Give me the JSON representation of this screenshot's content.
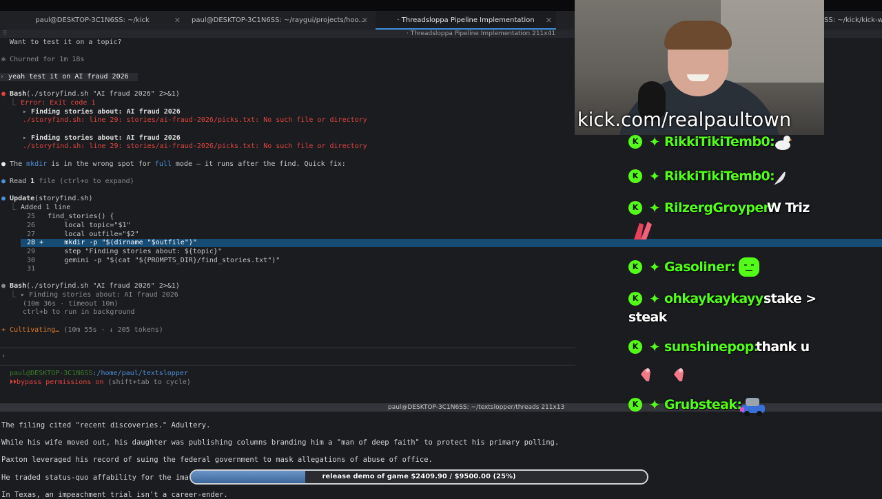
{
  "tabs": [
    {
      "label": "paul@DESKTOP-3C1N6SS: ~/kick"
    },
    {
      "label": "paul@DESKTOP-3C1N6SS: ~/raygui/projects/hoo..."
    },
    {
      "label": "· Threadsloppa Pipeline Implementation"
    },
    {
      "label": "SS: ~/kick/kick-w"
    }
  ],
  "pane1_title": "· Threadsloppa Pipeline Implementation 211x41",
  "terminal": {
    "line_question": "Want to test it on a topic?",
    "line_churned": "Churned for 1m 18s",
    "line_prompt": "yeah test it on AI fraud 2026",
    "bash1_name": "Bash",
    "bash1_args": "(./storyfind.sh \"AI fraud 2026\" 2>&1)",
    "bash1_error": "Error: Exit code 1",
    "find1": "Finding stories about: AI fraud 2026",
    "err1": "./storyfind.sh: line 29: stories/ai-fraud-2026/picks.txt: No such file or directory",
    "find2": "Finding stories about: AI fraud 2026",
    "err2": "./storyfind.sh: line 29: stories/ai-fraud-2026/picks.txt: No such file or directory",
    "explain_pre": "The ",
    "explain_mkdir": "mkdir",
    "explain_mid": " is in the wrong spot for ",
    "explain_full": "full",
    "explain_post": " mode — it runs after the find. Quick fix:",
    "read_label": "Read ",
    "read_bold": "1",
    "read_rest": " file (ctrl+o to expand)",
    "update_name": "Update",
    "update_args": "(storyfind.sh)",
    "update_added": "Added 1 line",
    "code": [
      {
        "num": "25",
        "mark": " ",
        "text": "find_stories() {"
      },
      {
        "num": "26",
        "mark": " ",
        "text": "    local topic=\"$1\""
      },
      {
        "num": "27",
        "mark": " ",
        "text": "    local outfile=\"$2\""
      },
      {
        "num": "28",
        "mark": "+",
        "text": "    mkdir -p \"$(dirname \"$outfile\")\""
      },
      {
        "num": "29",
        "mark": " ",
        "text": "    step \"Finding stories about: ${topic}\""
      },
      {
        "num": "30",
        "mark": " ",
        "text": "    gemini -p \"$(cat \"${PROMPTS_DIR}/find_stories.txt\")\""
      },
      {
        "num": "31",
        "mark": " ",
        "text": ""
      }
    ],
    "bash2_name": "Bash",
    "bash2_args": "(./storyfind.sh \"AI fraud 2026\" 2>&1)",
    "bash2_find": "Finding stories about: AI fraud 2026",
    "bash2_time": "(10m 36s · timeout 10m)",
    "bash2_bg": "ctrl+b to run in background",
    "cultivating": "Cultivating…",
    "cultivating_meta": "(10m 55s · ↓ 205 tokens)",
    "cursor": "›",
    "shell_user": "paul@DESKTOP-3C1N6SS",
    "shell_path": ":/home/paul/textslopper",
    "bypass_bold": "bypass permissions on",
    "bypass_rest": " (shift+tab to cycle)"
  },
  "pane2_title": "paul@DESKTOP-3C1N6SS: ~/textslopper/threads 211x13",
  "pane2_lines": [
    "The filing cited \"recent discoveries.\" Adultery.",
    "While his wife moved out, his daughter was publishing columns branding him a \"man of deep faith\" to protect his primary polling.",
    "Paxton leveraged his record of suing the federal government to mask allegations of abuse of office.",
    "He traded status-quo affability for the ima",
    "In Texas, an impeachment trial isn't a career-ender."
  ],
  "stream_url": "kick.com/realpaultown",
  "chat": [
    {
      "user": "RikkiTikiTemb0:",
      "text": "",
      "emote": "duck"
    },
    {
      "user": "RikkiTikiTemb0:",
      "text": "",
      "emote": "feather"
    },
    {
      "user": "RilzergGroyper:",
      "text": "W Triz",
      "emote": "hands"
    },
    {
      "user": "Gasoliner:",
      "text": "",
      "emote": "blob"
    },
    {
      "user": "ohkaykaykayy:",
      "text": "stake >",
      "cont": "steak"
    },
    {
      "user": "sunshinepop:",
      "text": "thank u",
      "emote": "birds"
    },
    {
      "user": "Grubsteak:",
      "text": "",
      "emote": "car"
    }
  ],
  "progress": {
    "label": "release demo of game $2409.90 / $9500.00 (25%)",
    "fraction": 0.25
  },
  "colors": {
    "kick_green": "#53fc18",
    "error_red": "#e0443e",
    "highlight_row": "#164b74",
    "progress_fill": "#3b679c"
  }
}
